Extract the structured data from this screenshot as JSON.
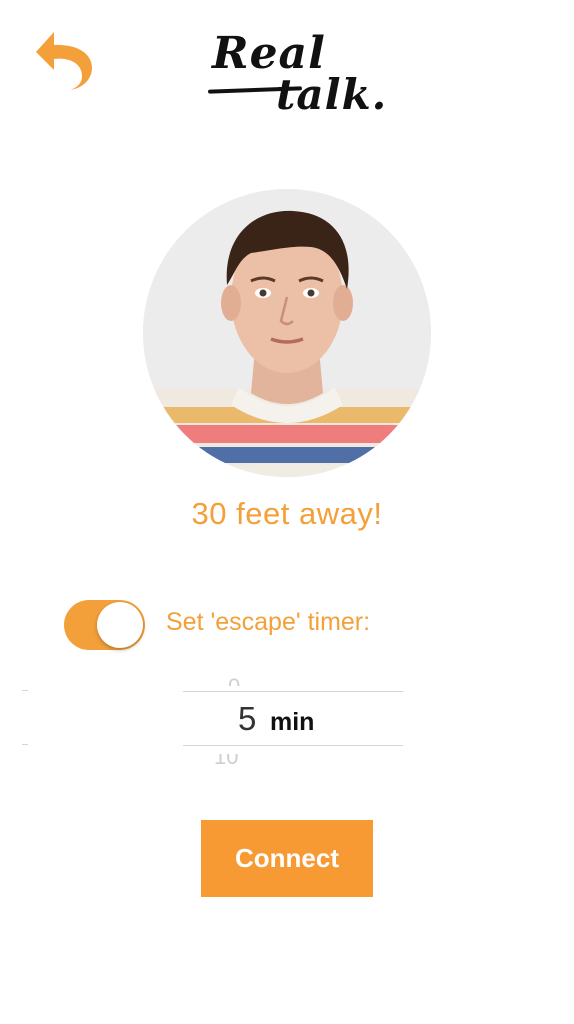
{
  "app": {
    "logo_line1": "Real",
    "logo_line2": "talk."
  },
  "colors": {
    "accent": "#f4a03a",
    "button": "#f89a33"
  },
  "header": {
    "back_icon": "undo-arrow-icon"
  },
  "match": {
    "distance_text": "30 feet away!"
  },
  "timer": {
    "toggle_on": true,
    "label": "Set 'escape' timer:",
    "picker": {
      "above": "0",
      "value": "5",
      "unit": "min",
      "below": "10"
    }
  },
  "actions": {
    "connect_label": "Connect"
  }
}
